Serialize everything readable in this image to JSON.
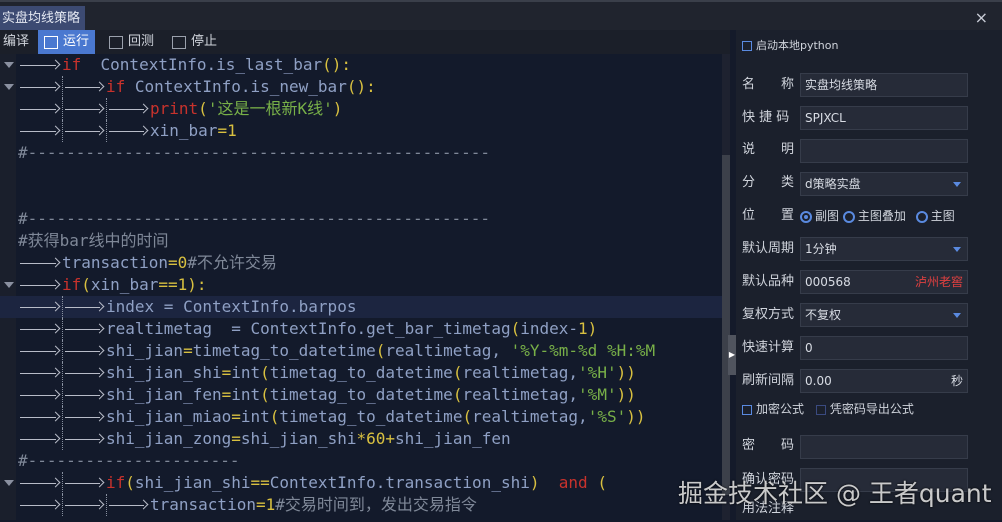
{
  "window": {
    "tab": "实盘均线策略",
    "close": "×"
  },
  "toolbar": {
    "compile": "编译",
    "run": "运行",
    "backtest": "回测",
    "stop": "停止"
  },
  "code": [
    {
      "fold": true,
      "indent": 1,
      "tokens": [
        [
          "kw",
          "if"
        ],
        [
          "tx",
          "  ContextInfo.is_last_bar"
        ],
        [
          "pun",
          "():"
        ]
      ]
    },
    {
      "fold": true,
      "indent": 2,
      "tokens": [
        [
          "kw",
          "if"
        ],
        [
          "tx",
          " ContextInfo.is_new_bar"
        ],
        [
          "pun",
          "():"
        ]
      ]
    },
    {
      "indent": 3,
      "tokens": [
        [
          "kw",
          "print"
        ],
        [
          "pun",
          "("
        ],
        [
          "str",
          "'这是一根新K线'"
        ],
        [
          "pun",
          ")"
        ]
      ]
    },
    {
      "indent": 3,
      "tokens": [
        [
          "tx",
          "xin_bar"
        ],
        [
          "op",
          "="
        ],
        [
          "num",
          "1"
        ]
      ]
    },
    {
      "indent": 0,
      "tokens": [
        [
          "cm",
          "#------------------------------------------------"
        ]
      ]
    },
    {
      "indent": 0,
      "tokens": []
    },
    {
      "indent": 0,
      "tokens": []
    },
    {
      "indent": 0,
      "tokens": [
        [
          "cm",
          "#------------------------------------------------"
        ]
      ]
    },
    {
      "indent": 0,
      "tokens": [
        [
          "cm",
          "#获得bar线中的时间"
        ]
      ]
    },
    {
      "indent": 1,
      "tokens": [
        [
          "tx",
          "transaction"
        ],
        [
          "op",
          "="
        ],
        [
          "num",
          "0"
        ],
        [
          "cm",
          "#不允许交易"
        ]
      ]
    },
    {
      "fold": true,
      "indent": 1,
      "tokens": [
        [
          "kw",
          "if"
        ],
        [
          "pun",
          "("
        ],
        [
          "tx",
          "xin_bar"
        ],
        [
          "op",
          "=="
        ],
        [
          "num",
          "1"
        ],
        [
          "pun",
          "):"
        ]
      ]
    },
    {
      "hl": true,
      "indent": 2,
      "tokens": [
        [
          "tx",
          "index = ContextInfo.barpos"
        ]
      ]
    },
    {
      "indent": 2,
      "tokens": [
        [
          "tx",
          "realtimetag  = ContextInfo.get_bar_timetag"
        ],
        [
          "pun",
          "("
        ],
        [
          "tx",
          "index-"
        ],
        [
          "num",
          "1"
        ],
        [
          "pun",
          ")"
        ]
      ]
    },
    {
      "indent": 2,
      "tokens": [
        [
          "tx",
          "shi_jian"
        ],
        [
          "op",
          "="
        ],
        [
          "tx",
          "timetag_to_datetime"
        ],
        [
          "pun",
          "("
        ],
        [
          "tx",
          "realtimetag, "
        ],
        [
          "str",
          "'%Y-%m-%d %H:%M"
        ]
      ]
    },
    {
      "indent": 2,
      "tokens": [
        [
          "tx",
          "shi_jian_shi"
        ],
        [
          "op",
          "="
        ],
        [
          "tx",
          "int"
        ],
        [
          "pun",
          "("
        ],
        [
          "tx",
          "timetag_to_datetime"
        ],
        [
          "pun",
          "("
        ],
        [
          "tx",
          "realtimetag,"
        ],
        [
          "str",
          "'%H'"
        ],
        [
          "pun",
          "))"
        ]
      ]
    },
    {
      "indent": 2,
      "tokens": [
        [
          "tx",
          "shi_jian_fen"
        ],
        [
          "op",
          "="
        ],
        [
          "tx",
          "int"
        ],
        [
          "pun",
          "("
        ],
        [
          "tx",
          "timetag_to_datetime"
        ],
        [
          "pun",
          "("
        ],
        [
          "tx",
          "realtimetag,"
        ],
        [
          "str",
          "'%M'"
        ],
        [
          "pun",
          "))"
        ]
      ]
    },
    {
      "indent": 2,
      "tokens": [
        [
          "tx",
          "shi_jian_miao"
        ],
        [
          "op",
          "="
        ],
        [
          "tx",
          "int"
        ],
        [
          "pun",
          "("
        ],
        [
          "tx",
          "timetag_to_datetime"
        ],
        [
          "pun",
          "("
        ],
        [
          "tx",
          "realtimetag,"
        ],
        [
          "str",
          "'%S'"
        ],
        [
          "pun",
          "))"
        ]
      ]
    },
    {
      "indent": 2,
      "tokens": [
        [
          "tx",
          "shi_jian_zong"
        ],
        [
          "op",
          "="
        ],
        [
          "tx",
          "shi_jian_shi"
        ],
        [
          "op",
          "*"
        ],
        [
          "num",
          "60"
        ],
        [
          "op",
          "+"
        ],
        [
          "tx",
          "shi_jian_fen"
        ]
      ]
    },
    {
      "indent": 0,
      "tokens": [
        [
          "cm",
          "#----------------------"
        ]
      ]
    },
    {
      "fold": true,
      "indent": 2,
      "tokens": [
        [
          "kw",
          "if"
        ],
        [
          "pun",
          "("
        ],
        [
          "tx",
          "shi_jian_shi"
        ],
        [
          "op",
          "=="
        ],
        [
          "tx",
          "ContextInfo.transaction_shi"
        ],
        [
          "pun",
          ")"
        ],
        [
          "tx",
          "  "
        ],
        [
          "kw",
          "and"
        ],
        [
          "tx",
          " "
        ],
        [
          "pun",
          "("
        ]
      ]
    },
    {
      "indent": 3,
      "tokens": [
        [
          "tx",
          "transaction"
        ],
        [
          "op",
          "="
        ],
        [
          "num",
          "1"
        ],
        [
          "cm",
          "#交易时间到，发出交易指令"
        ]
      ]
    }
  ],
  "panel": {
    "local_python": "启动本地python",
    "name_label": "名　　称",
    "name_value": "实盘均线策略",
    "shortcut_label": "快 捷 码",
    "shortcut_value": "SPJXCL",
    "desc_label": "说　　明",
    "desc_value": "",
    "category_label": "分　　类",
    "category_value": "d策略实盘",
    "position_label": "位　　置",
    "position_options": [
      "副图",
      "主图叠加",
      "主图"
    ],
    "period_label": "默认周期",
    "period_value": "1分钟",
    "stock_label": "默认品种",
    "stock_code": "000568",
    "stock_name": "泸州老窖",
    "adjust_label": "复权方式",
    "adjust_value": "不复权",
    "fastcalc_label": "快速计算",
    "fastcalc_value": "0",
    "refresh_label": "刷新间隔",
    "refresh_value": "0.00",
    "refresh_unit": "秒",
    "encrypt": "加密公式",
    "export_pwd": "凭密码导出公式",
    "pwd_label": "密　　码",
    "confirm_label": "确认密码",
    "usage_label": "用法注释"
  },
  "watermark": "掘金技术社区 @ 王者quant"
}
